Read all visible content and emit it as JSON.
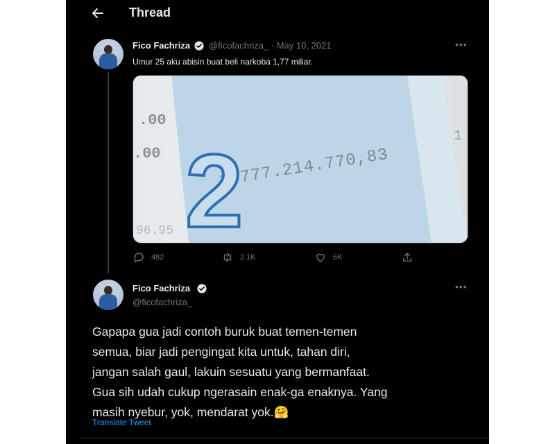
{
  "header": {
    "title": "Thread"
  },
  "tweet1": {
    "author_name": "Fico Fachriza",
    "handle_date": "@ficofachriza_ · May 10, 2021",
    "text": "Umur 25 aku abisin buat beli narkoba 1,77 miliar.",
    "media": {
      "big_digit": "2",
      "amount_text": "1.777.214.770,83",
      "left_text_top": ".00",
      "left_text_bottom": ".00",
      "bottom_left_text": "96.95"
    },
    "stats": {
      "replies": "482",
      "retweets": "2.1K",
      "likes": "6K"
    }
  },
  "tweet2": {
    "author_name": "Fico Fachriza",
    "handle": "@ficofachriza_",
    "text": "Gapapa gua jadi contoh buruk buat temen-temen\nsemua, biar jadi pengingat kita untuk, tahan diri,\njangan salah gaul, lakuin sesuatu yang bermanfaat.\nGua sih udah cukup ngerasain enak-ga enaknya. Yang\nmasih nyebur, yok, mendarat yok.🤗",
    "translate_label": "Translate Tweet"
  },
  "icons": {
    "back": "arrow-left-icon",
    "verified": "verified-badge-icon",
    "more": "more-horizontal-icon",
    "reply": "reply-icon",
    "retweet": "retweet-icon",
    "like": "heart-icon",
    "share": "share-icon"
  },
  "colors": {
    "background": "#000000",
    "text": "#e7e9ea",
    "secondary": "#71767b",
    "link": "#1d9bf0",
    "verified": "#1d9bf0"
  }
}
